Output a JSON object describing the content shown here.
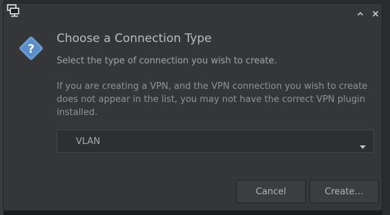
{
  "window": {
    "icon": "network-connection-icon",
    "controls": [
      "maximize-icon",
      "close-icon"
    ]
  },
  "dialog": {
    "icon": "question-icon",
    "title": "Choose a Connection Type",
    "subtitle": "Select the type of connection you wish to create.",
    "description": "If you are creating a VPN, and the VPN connection you wish to create does not appear in the list, you may not have the correct VPN plugin installed."
  },
  "connection_type": {
    "selected": "VLAN",
    "icon": "dropdown-arrow-icon"
  },
  "buttons": {
    "cancel_label": "Cancel",
    "create_label": "Create…"
  },
  "colors": {
    "window_bg": "#353638",
    "icon_blue": "#5b8ec6",
    "text": "#b9bcbf"
  }
}
